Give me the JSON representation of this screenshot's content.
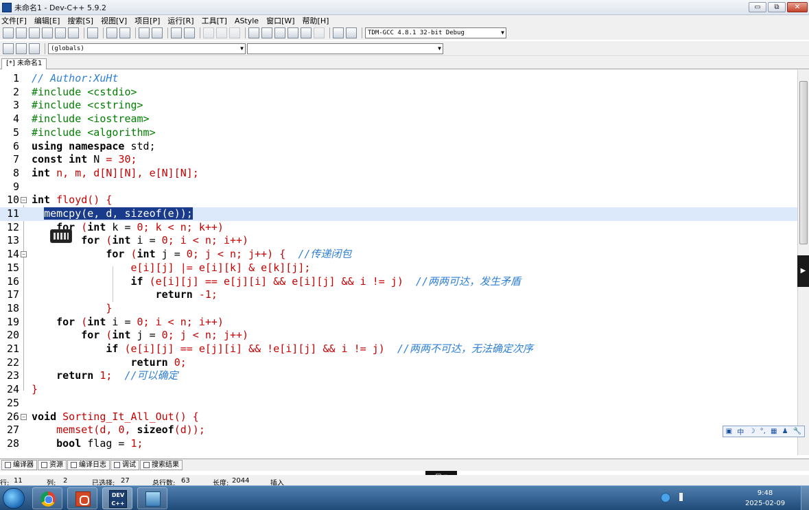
{
  "window": {
    "title": "未命名1 - Dev-C++ 5.9.2",
    "buttons": [
      "▭",
      "⧉",
      "✕"
    ]
  },
  "menu": [
    "文件[F]",
    "编辑[E]",
    "搜索[S]",
    "视图[V]",
    "项目[P]",
    "运行[R]",
    "工具[T]",
    "AStyle",
    "窗口[W]",
    "帮助[H]"
  ],
  "toolbar": {
    "compiler": "TDM-GCC 4.8.1 32-bit Debug",
    "scope": "(globals)",
    "function": ""
  },
  "tab": "[*] 未命名1",
  "code": [
    {
      "n": "1"
    },
    {
      "n": "2"
    },
    {
      "n": "3"
    },
    {
      "n": "4"
    },
    {
      "n": "5"
    },
    {
      "n": "6"
    },
    {
      "n": "7"
    },
    {
      "n": "8"
    },
    {
      "n": "9"
    },
    {
      "n": "10"
    },
    {
      "n": "11"
    },
    {
      "n": "12"
    },
    {
      "n": "13"
    },
    {
      "n": "14"
    },
    {
      "n": "15"
    },
    {
      "n": "16"
    },
    {
      "n": "17"
    },
    {
      "n": "18"
    },
    {
      "n": "19"
    },
    {
      "n": "20"
    },
    {
      "n": "21"
    },
    {
      "n": "22"
    },
    {
      "n": "23"
    },
    {
      "n": "24"
    },
    {
      "n": "25"
    },
    {
      "n": "26"
    },
    {
      "n": "27"
    },
    {
      "n": "28"
    }
  ],
  "source": {
    "l1": "// Author:XuHt",
    "l2a": "#include",
    "l2b": " <cstdio>",
    "l3a": "#include",
    "l3b": " <cstring>",
    "l4a": "#include",
    "l4b": " <iostream>",
    "l5a": "#include",
    "l5b": " <algorithm>",
    "l6a": "using namespace",
    "l6b": " std;",
    "l7a": "const int",
    "l7b": " N ",
    "l7c": "=",
    "l7d": " ",
    "l7e": "30",
    "l7f": ";",
    "l8a": "int",
    "l8b": " n, m, d[N][N], e[N][N];",
    "l10a": "int",
    "l10b": " floyd() {",
    "l11": "memcpy(e, d, sizeof(e));",
    "l12a": "for",
    "l12b": " (",
    "l12c": "int",
    "l12d": " k = ",
    "l12e": "0",
    "l12f": "; k < n; k++)",
    "l13a": "for",
    "l13b": " (",
    "l13c": "int",
    "l13d": " i = ",
    "l13e": "0",
    "l13f": "; i < n; i++)",
    "l14a": "for",
    "l14b": " (",
    "l14c": "int",
    "l14d": " j = ",
    "l14e": "0",
    "l14f": "; j < n; j++) {  ",
    "l14g": "//传递闭包",
    "l15": "e[i][j] |= e[i][k] & e[k][j];",
    "l16a": "if",
    "l16b": " (e[i][j] == e[j][i] && e[i][j] && i != j)  ",
    "l16c": "//两两可达，发生矛盾",
    "l17a": "return",
    "l17b": " -1;",
    "l18": "}",
    "l19a": "for",
    "l19b": " (",
    "l19c": "int",
    "l19d": " i = ",
    "l19e": "0",
    "l19f": "; i < n; i++)",
    "l20a": "for",
    "l20b": " (",
    "l20c": "int",
    "l20d": " j = ",
    "l20e": "0",
    "l20f": "; j < n; j++)",
    "l21a": "if",
    "l21b": " (e[i][j] == e[j][i] && !e[i][j] && i != j)  ",
    "l21c": "//两两不可达，无法确定次序",
    "l22a": "return",
    "l22b": " 0;",
    "l23a": "return",
    "l23b": " 1;  ",
    "l23c": "//可以确定",
    "l24": "}",
    "l26a": "void",
    "l26b": " Sorting_It_All_Out() {",
    "l27a": "memset(d, ",
    "l27b": "0",
    "l27c": ", ",
    "l27d": "sizeof",
    "l27e": "(d));",
    "l28a": "bool",
    "l28b": " flag = ",
    "l28c": "1",
    "l28d": ";"
  },
  "ime": [
    "中",
    "☽",
    "°,",
    "▦",
    "♟",
    "🔧"
  ],
  "bottom_tabs": [
    "编译器",
    "资源",
    "编译日志",
    "调试",
    "搜索结果"
  ],
  "status": {
    "row_label": "行:",
    "row": "11",
    "col_label": "列:",
    "col": "2",
    "sel_label": "已选择:",
    "sel": "27",
    "lines_label": "总行数:",
    "lines": "63",
    "len_label": "长度:",
    "len": "2044",
    "mode": "插入"
  },
  "taskbar": {
    "time": "9:48",
    "date": "2025-02-09"
  }
}
